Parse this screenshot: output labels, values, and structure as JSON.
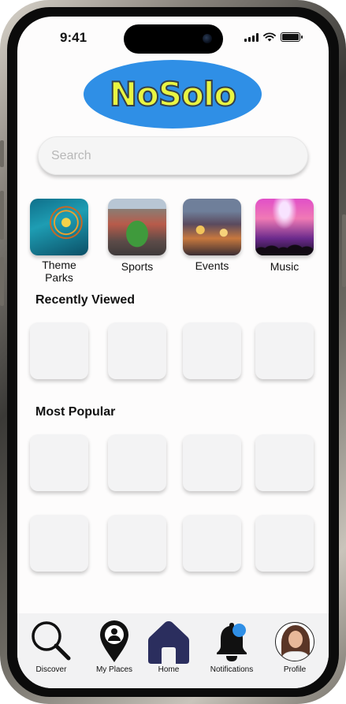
{
  "status_bar": {
    "time": "9:41"
  },
  "logo": {
    "text": "NoSolo"
  },
  "search": {
    "placeholder": "Search"
  },
  "categories": [
    {
      "label": "Theme Parks",
      "image": "theme-park-ride-photo"
    },
    {
      "label": "Sports",
      "image": "stadium-photo"
    },
    {
      "label": "Events",
      "image": "street-festival-photo"
    },
    {
      "label": "Music",
      "image": "concert-crowd-photo"
    }
  ],
  "sections": {
    "recently_viewed": "Recently Viewed",
    "most_popular": "Most Popular"
  },
  "tabbar": {
    "items": [
      {
        "label": "Discover",
        "icon": "magnifier-icon"
      },
      {
        "label": "My Places",
        "icon": "map-pin-person-icon"
      },
      {
        "label": "Home",
        "icon": "home-icon",
        "active": true
      },
      {
        "label": "Notifications",
        "icon": "bell-icon",
        "badge": true
      },
      {
        "label": "Profile",
        "icon": "avatar-photo"
      }
    ]
  },
  "colors": {
    "accent_blue": "#2f8fe6",
    "logo_yellow": "#e9f542",
    "home_navy": "#2b2e5e",
    "tile_gray": "#f3f3f4"
  }
}
